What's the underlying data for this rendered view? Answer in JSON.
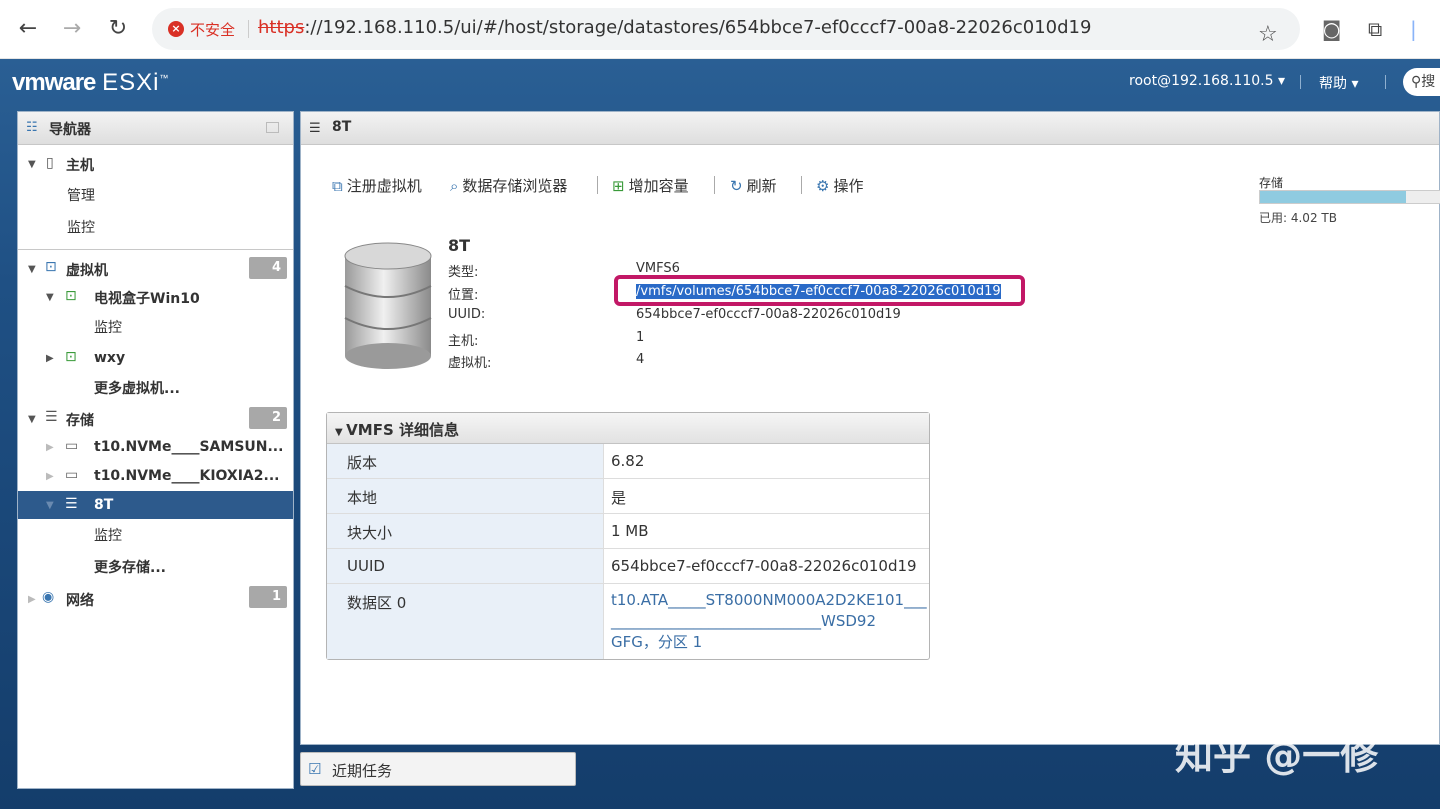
{
  "browser": {
    "security_text": "不安全",
    "url_scheme": "https",
    "url_rest": "://192.168.110.5/ui/#/host/storage/datastores/654bbce7-ef0cccf7-00a8-22026c010d19"
  },
  "header": {
    "logo_brand": "vmware",
    "logo_product": "ESXi",
    "user_menu": "root@192.168.110.5 ▾",
    "help_menu": "帮助 ▾",
    "search_placeholder": "搜"
  },
  "navigator": {
    "title": "导航器",
    "host": {
      "label": "主机",
      "items": [
        "管理",
        "监控"
      ]
    },
    "vms": {
      "label": "虚拟机",
      "count": "4",
      "vm1": "电视盒子Win10",
      "vm1_monitor": "监控",
      "vm2": "wxy",
      "more": "更多虚拟机..."
    },
    "storage": {
      "label": "存储",
      "count": "2",
      "ds1": "t10.NVMe____SAMSUN...",
      "ds2": "t10.NVMe____KIOXIA2...",
      "ds3": "8T",
      "monitor": "监控",
      "more": "更多存储..."
    },
    "network": {
      "label": "网络",
      "count": "1"
    }
  },
  "main": {
    "tab_title": "8T",
    "toolbar": {
      "register_vm": "注册虚拟机",
      "datastore_browser": "数据存储浏览器",
      "increase_capacity": "增加容量",
      "refresh": "刷新",
      "actions": "操作"
    },
    "datastore": {
      "name": "8T",
      "type_label": "类型:",
      "type_value": "VMFS6",
      "location_label": "位置:",
      "location_value": "/vmfs/volumes/654bbce7-ef0cccf7-00a8-22026c010d19",
      "uuid_label": "UUID:",
      "uuid_value": "654bbce7-ef0cccf7-00a8-22026c010d19",
      "hosts_label": "主机:",
      "hosts_value": "1",
      "vms_label": "虚拟机:",
      "vms_value": "4"
    },
    "storage_widget": {
      "label": "存储",
      "used_label": "已用: 4.02 TB",
      "used_fraction": 0.81
    },
    "vmfs": {
      "title": "VMFS 详细信息",
      "rows": [
        {
          "k": "版本",
          "v": "6.82"
        },
        {
          "k": "本地",
          "v": "是"
        },
        {
          "k": "块大小",
          "v": "1 MB"
        },
        {
          "k": "UUID",
          "v": "654bbce7-ef0cccf7-00a8-22026c010d19"
        },
        {
          "k": "数据区 0",
          "v1": "t10.ATA_____ST8000NM000A2D2KE101___",
          "v2": "____________________________WSD92",
          "v3": "GFG，分区 1"
        }
      ]
    }
  },
  "recent_tasks": "近期任务",
  "watermark": "知乎 @一修"
}
